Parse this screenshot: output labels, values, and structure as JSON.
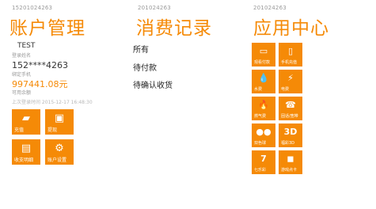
{
  "account_panel": {
    "account_number": "15201024263",
    "title": "账户管理",
    "username": "TEST",
    "username_label": "登录姓名",
    "phone": "152****4263",
    "phone_label": "绑定手机",
    "balance": "997441.08元",
    "balance_label": "可用余额",
    "last_login": "上次登录时间 2015-12-17 16:48:30",
    "tiles": [
      {
        "label": "充值",
        "icon": "card-icon"
      },
      {
        "label": "提现",
        "icon": "withdraw-icon"
      },
      {
        "label": "收支明细",
        "icon": "document-icon"
      },
      {
        "label": "账户设置",
        "icon": "gear-icon"
      }
    ]
  },
  "orders_panel": {
    "account_number": "201024263",
    "title": "消费记录",
    "items": [
      "所有",
      "待付款",
      "待确认收货"
    ]
  },
  "apps_panel": {
    "account_number": "201024263",
    "title": "应用中心",
    "tiles": [
      {
        "label": "观看付款",
        "icon": "ticket-icon"
      },
      {
        "label": "手机充值",
        "icon": "phone-icon"
      },
      {
        "label": "水费",
        "icon": "water-drop-icon"
      },
      {
        "label": "电费",
        "icon": "lightning-icon"
      },
      {
        "label": "燃气费",
        "icon": "flame-icon"
      },
      {
        "label": "固话/宽带",
        "icon": "telephone-icon"
      },
      {
        "label": "双色球",
        "icon": "lottery-balls-icon"
      },
      {
        "label": "福彩3D",
        "icon": "3d-icon"
      },
      {
        "label": "七乐彩",
        "icon": "lottery-7-icon"
      },
      {
        "label": "游戏点卡",
        "icon": "game-card-icon"
      }
    ]
  },
  "colors": {
    "accent": "#f58a07"
  }
}
